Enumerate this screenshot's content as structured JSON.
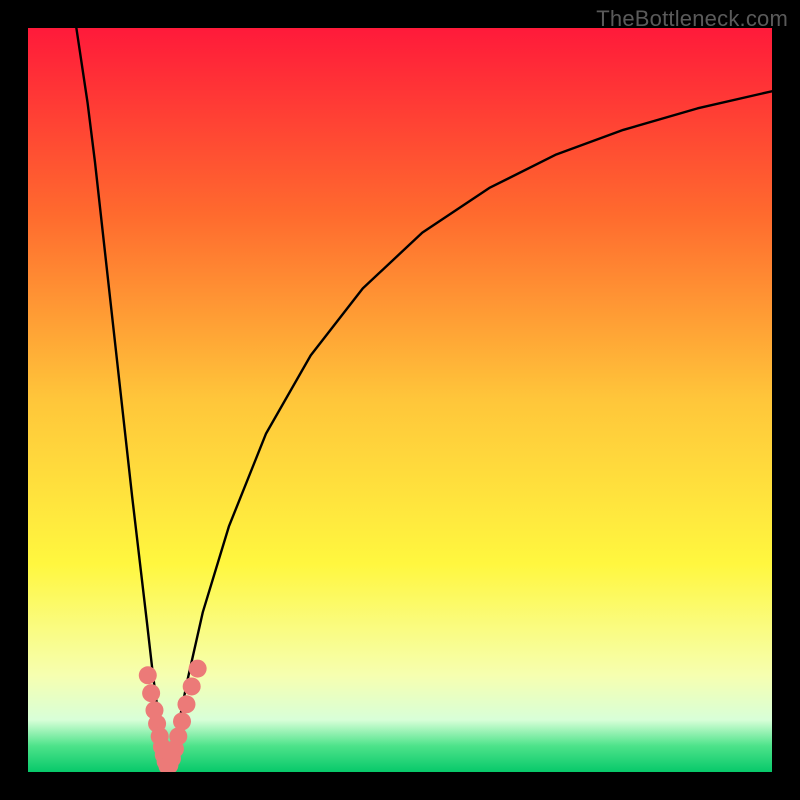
{
  "watermark": {
    "text": "TheBottleneck.com"
  },
  "chart_data": {
    "type": "line",
    "title": "",
    "xlabel": "",
    "ylabel": "",
    "xlim": [
      0,
      100
    ],
    "ylim": [
      0,
      100
    ],
    "grid": false,
    "legend": null,
    "gradient_stops": [
      {
        "offset": 0.0,
        "color": "#ff1a3a"
      },
      {
        "offset": 0.25,
        "color": "#ff6a2e"
      },
      {
        "offset": 0.5,
        "color": "#ffc63a"
      },
      {
        "offset": 0.72,
        "color": "#fff73f"
      },
      {
        "offset": 0.87,
        "color": "#f6ffb0"
      },
      {
        "offset": 0.93,
        "color": "#d8ffd8"
      },
      {
        "offset": 0.965,
        "color": "#4de38a"
      },
      {
        "offset": 1.0,
        "color": "#07c96a"
      }
    ],
    "series": [
      {
        "name": "left-branch",
        "color": "#000000",
        "x": [
          6.5,
          8,
          9,
          10,
          11,
          12,
          13,
          14,
          15,
          16,
          16.8,
          17.5,
          17.9,
          18.2,
          18.45
        ],
        "y": [
          100,
          90,
          82,
          73,
          64,
          55,
          46,
          37,
          28.5,
          20,
          13,
          7.8,
          4.4,
          2.2,
          0.9
        ]
      },
      {
        "name": "right-branch",
        "color": "#000000",
        "x": [
          19.1,
          19.6,
          20.3,
          21.4,
          23.5,
          27,
          32,
          38,
          45,
          53,
          62,
          71,
          80,
          90,
          100
        ],
        "y": [
          1.2,
          3.2,
          6.7,
          12.2,
          21.5,
          33,
          45.5,
          56,
          65,
          72.5,
          78.5,
          83,
          86.3,
          89.2,
          91.5
        ]
      },
      {
        "name": "trough-dots-left",
        "style": "dots",
        "color": "#ec7a78",
        "x": [
          16.1,
          16.55,
          17.0,
          17.35,
          17.7,
          18.0,
          18.25,
          18.5,
          18.75
        ],
        "y": [
          13.0,
          10.6,
          8.3,
          6.5,
          4.8,
          3.4,
          2.3,
          1.4,
          0.8
        ]
      },
      {
        "name": "trough-dots-right",
        "style": "dots",
        "color": "#ec7a78",
        "x": [
          19.0,
          19.35,
          19.75,
          20.2,
          20.7,
          21.3,
          22.0,
          22.8
        ],
        "y": [
          0.9,
          1.8,
          3.1,
          4.8,
          6.8,
          9.1,
          11.5,
          13.9
        ]
      }
    ]
  }
}
